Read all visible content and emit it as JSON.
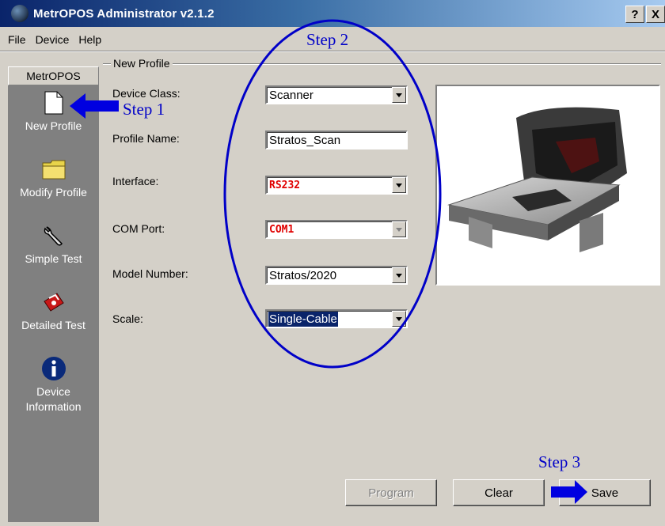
{
  "window": {
    "title": "MetrOPOS Administrator v2.1.2",
    "help_btn": "?",
    "close_btn": "X"
  },
  "menu": [
    "File",
    "Device",
    "Help"
  ],
  "sidebar": {
    "header": "MetrOPOS",
    "items": [
      {
        "label": "New Profile",
        "icon": "document-icon"
      },
      {
        "label": "Modify Profile",
        "icon": "folder-icon"
      },
      {
        "label": "Simple Test",
        "icon": "wrench-icon"
      },
      {
        "label": "Detailed Test",
        "icon": "toolbox-icon"
      },
      {
        "label": "Device Information",
        "icon": "info-icon"
      }
    ]
  },
  "form": {
    "group_title": "New Profile",
    "device_class": {
      "label": "Device Class:",
      "value": "Scanner"
    },
    "profile_name": {
      "label": "Profile Name:",
      "value": "Stratos_Scan"
    },
    "interface": {
      "label": "Interface:",
      "value": "RS232"
    },
    "com_port": {
      "label": "COM Port:",
      "value": "COM1"
    },
    "model_number": {
      "label": "Model Number:",
      "value": "Stratos/2020"
    },
    "scale": {
      "label": "Scale:",
      "value": "Single-Cable"
    }
  },
  "buttons": {
    "program": "Program",
    "clear": "Clear",
    "save": "Save"
  },
  "annotations": {
    "step1": "Step 1",
    "step2": "Step 2",
    "step3": "Step 3",
    "color": "#0000c8"
  }
}
